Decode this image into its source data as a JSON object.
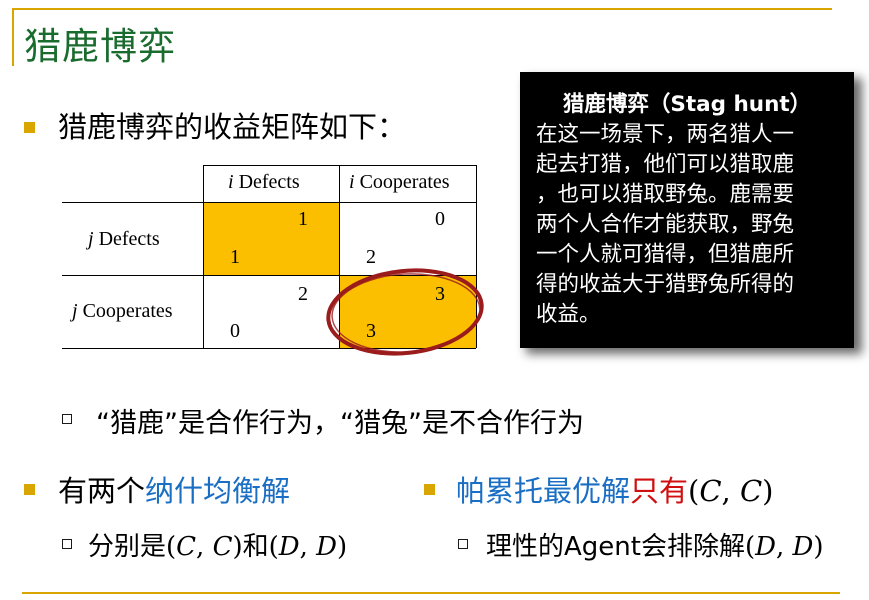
{
  "title": "猎鹿博弈",
  "heading": "猎鹿博弈的收益矩阵如下：",
  "payoff_table": {
    "col_headers": [
      {
        "var": "i",
        "label": "Defects"
      },
      {
        "var": "i",
        "label": "Cooperates"
      }
    ],
    "row_headers": [
      {
        "var": "j",
        "label": "Defects"
      },
      {
        "var": "j",
        "label": "Cooperates"
      }
    ],
    "cells": [
      [
        {
          "top": "1",
          "bottom": "1",
          "highlight": true
        },
        {
          "top": "0",
          "bottom": "2",
          "highlight": false
        }
      ],
      [
        {
          "top": "2",
          "bottom": "0",
          "highlight": false
        },
        {
          "top": "3",
          "bottom": "3",
          "highlight": true,
          "circled": true
        }
      ]
    ],
    "highlight_color": "#fbbf00",
    "circle_color": "#9b1c1c"
  },
  "info_box": {
    "title": "猎鹿博弈（Stag hunt）",
    "lines": [
      "在这一场景下，两名猎人一",
      "起去打猎，他们可以猎取鹿",
      "，也可以猎取野兔。鹿需要",
      "两个人合作才能获取，野兔",
      "一个人就可猎得，但猎鹿所",
      "得的收益大于猎野兔所得的",
      "收益。"
    ]
  },
  "sub_note": "“猎鹿”是合作行为，“猎兔”是不合作行为",
  "left_point": {
    "prefix": "有两个",
    "highlight": "纳什均衡解",
    "sub_prefix": "分别是",
    "sub_math1": "(𝐶, 𝐶)",
    "sub_mid": "和",
    "sub_math2": "(𝐷, 𝐷)"
  },
  "right_point": {
    "highlight": "帕累托最优解",
    "red_text": "只有",
    "math": "(𝐶, 𝐶)",
    "sub_prefix": "理性的Agent会排除解",
    "sub_math": "(𝐷, 𝐷)"
  },
  "colors": {
    "title": "#1a6b2e",
    "accent_rule": "#d9a600",
    "blue": "#1a6fc4",
    "red": "#d01010"
  }
}
